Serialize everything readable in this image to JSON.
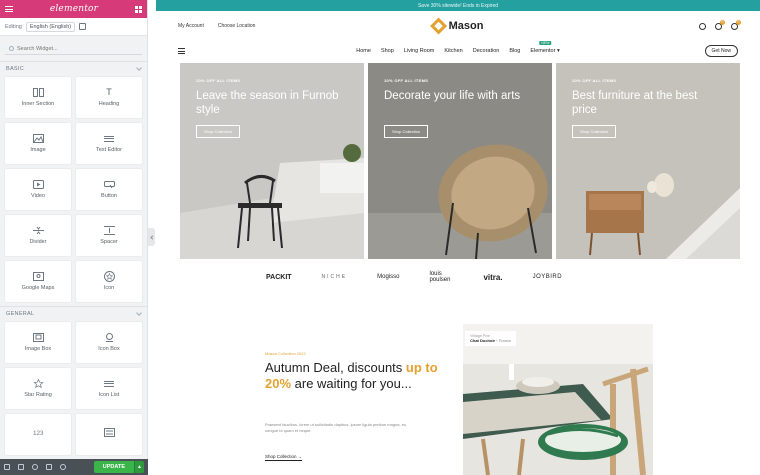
{
  "panel": {
    "logo": "elementor",
    "editing_label": "Editing",
    "language": "English (English)",
    "search_placeholder": "Search Widget...",
    "sections": [
      {
        "title": "BASIC",
        "widgets": [
          {
            "label": "Inner Section",
            "icon": "columns-icon"
          },
          {
            "label": "Heading",
            "icon": "heading-icon"
          },
          {
            "label": "Image",
            "icon": "image-icon"
          },
          {
            "label": "Text Editor",
            "icon": "text-editor-icon"
          },
          {
            "label": "Video",
            "icon": "video-icon"
          },
          {
            "label": "Button",
            "icon": "button-icon"
          },
          {
            "label": "Divider",
            "icon": "divider-icon"
          },
          {
            "label": "Spacer",
            "icon": "spacer-icon"
          },
          {
            "label": "Google Maps",
            "icon": "map-pin-icon"
          },
          {
            "label": "Icon",
            "icon": "star-circle-icon"
          }
        ]
      },
      {
        "title": "GENERAL",
        "widgets": [
          {
            "label": "Image Box",
            "icon": "image-box-icon"
          },
          {
            "label": "Icon Box",
            "icon": "icon-box-icon"
          },
          {
            "label": "Star Rating",
            "icon": "star-rating-icon"
          },
          {
            "label": "Icon List",
            "icon": "icon-list-icon"
          },
          {
            "label": "",
            "icon": "counter-icon"
          },
          {
            "label": "",
            "icon": "progress-icon"
          }
        ]
      }
    ],
    "footer": {
      "update_label": "UPDATE"
    }
  },
  "site": {
    "announcement": "Save 30% sitewide! Ends in Expired",
    "header_links": [
      "My Account",
      "Choose Location"
    ],
    "logo": "Mason",
    "wishlist_count": "0",
    "cart_count": "0",
    "nav": [
      "Home",
      "Shop",
      "Living Room",
      "Kitchen",
      "Decoration",
      "Blog"
    ],
    "nav_elementor": "Elementor",
    "nav_new_badge": "NEW",
    "get_now": "Get Now",
    "banners": [
      {
        "tag": "10% OFF ALL ITEMS",
        "title": "Leave the season in Furnob style",
        "button": "Shop Collection"
      },
      {
        "tag": "10% OFF ALL ITEMS",
        "title": "Decorate your life with arts",
        "button": "Shop Collection"
      },
      {
        "tag": "10% OFF ALL ITEMS",
        "title": "Best furniture at the best price",
        "button": "Shop Collection"
      }
    ],
    "brands": [
      "PACKIT",
      "NICHE",
      "Mogisso",
      "louis poulsen",
      "vitra.",
      "JOYBIRD"
    ],
    "promo": {
      "subtitle": "Mason Collection 2022",
      "title_start": "Autumn Deal, discounts ",
      "title_highlight": "up to 20%",
      "title_end": " are waiting for you...",
      "body": "Praesent faucibus, lorem ut sollicitudin dapibus, ipsum ligula pretium magna, eu congue ut quam et neque.",
      "link": "Shop Collection",
      "caption_top": "Vintage Pine",
      "caption_name": "Chat Duchoir",
      "caption_country": "France"
    }
  },
  "colors": {
    "elementor_pink": "#d63a78",
    "accent_gold": "#e3a12f",
    "announce_teal": "#24a0a0",
    "update_green": "#39b54a"
  }
}
